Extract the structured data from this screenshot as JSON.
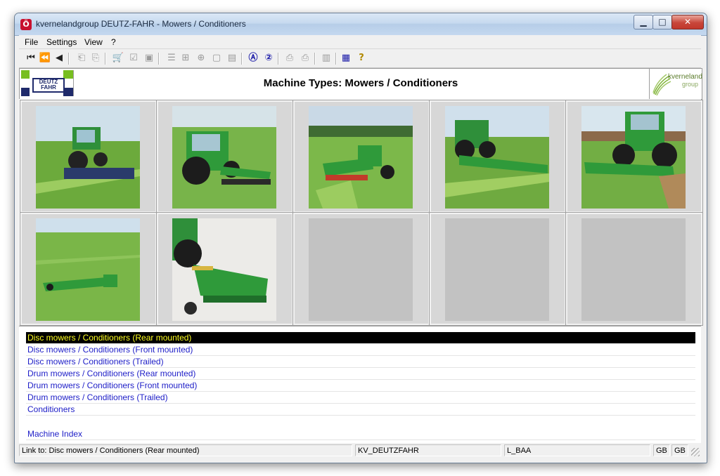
{
  "window": {
    "title": "kvernelandgroup DEUTZ-FAHR - Mowers / Conditioners",
    "app_icon": "Ö",
    "controls": {
      "minimize": "▁",
      "maximize": "□",
      "close": "✕"
    }
  },
  "menu": {
    "items": [
      {
        "label": "File"
      },
      {
        "label": "Settings"
      },
      {
        "label": "View"
      },
      {
        "label": "?"
      }
    ]
  },
  "toolbar": {
    "buttons": [
      {
        "icon": "first-page-icon",
        "glyph": "⏮"
      },
      {
        "icon": "fast-back-icon",
        "glyph": "⏪"
      },
      {
        "icon": "back-icon",
        "glyph": "◀"
      },
      {
        "icon": "doc-prev-icon",
        "glyph": "⎗"
      },
      {
        "icon": "doc-next-icon",
        "glyph": "⎘"
      },
      {
        "icon": "cart-icon",
        "glyph": "🛒"
      },
      {
        "icon": "checklist-icon",
        "glyph": "☑"
      },
      {
        "icon": "stamp-icon",
        "glyph": "▣"
      },
      {
        "icon": "text-doc-icon",
        "glyph": "☰"
      },
      {
        "icon": "tree-icon",
        "glyph": "⊞"
      },
      {
        "icon": "zoom-icon",
        "glyph": "⊕"
      },
      {
        "icon": "page-icon",
        "glyph": "▢"
      },
      {
        "icon": "pages-icon",
        "glyph": "▤"
      },
      {
        "icon": "search-a-icon",
        "glyph": "Ⓐ"
      },
      {
        "icon": "search-2-icon",
        "glyph": "②"
      },
      {
        "icon": "print-icon",
        "glyph": "⎙"
      },
      {
        "icon": "print-preview-icon",
        "glyph": "⎙"
      },
      {
        "icon": "book-icon",
        "glyph": "▥"
      },
      {
        "icon": "grid-icon",
        "glyph": "▦"
      },
      {
        "icon": "help-icon",
        "glyph": "?"
      }
    ]
  },
  "header": {
    "title": "Machine Types: Mowers / Conditioners",
    "left_logo": "DEUTZ FAHR",
    "right_logo_line1": "kverneland",
    "right_logo_line2": "group"
  },
  "grid": {
    "tiles": [
      {
        "id": 1,
        "kind": "rear-mower"
      },
      {
        "id": 2,
        "kind": "front-mower"
      },
      {
        "id": 3,
        "kind": "trailed-field"
      },
      {
        "id": 4,
        "kind": "wide-rear"
      },
      {
        "id": 5,
        "kind": "front-wide"
      },
      {
        "id": 6,
        "kind": "trailed-distant"
      },
      {
        "id": 7,
        "kind": "studio-conditioner"
      },
      {
        "id": 8,
        "kind": "empty"
      },
      {
        "id": 9,
        "kind": "empty"
      },
      {
        "id": 10,
        "kind": "empty"
      }
    ]
  },
  "links": {
    "items": [
      {
        "label": "Disc mowers / Conditioners (Rear mounted)",
        "selected": true
      },
      {
        "label": "Disc mowers / Conditioners (Front mounted)"
      },
      {
        "label": "Disc mowers / Conditioners (Trailed)"
      },
      {
        "label": "Drum mowers / Conditioners (Rear mounted)"
      },
      {
        "label": "Drum mowers / Conditioners (Front mounted)"
      },
      {
        "label": "Drum mowers / Conditioners (Trailed)"
      },
      {
        "label": "Conditioners"
      }
    ],
    "machine_index": "Machine Index"
  },
  "status": {
    "link_text": "Link to: Disc mowers / Conditioners (Rear mounted)",
    "database": "KV_DEUTZFAHR",
    "code": "L_BAA",
    "lang1": "GB",
    "lang2": "GB"
  },
  "colors": {
    "link": "#2020c8",
    "selected_bg": "#000000",
    "selected_fg": "#ffff20",
    "tractor_green": "#2f9a3a",
    "grass": "#6cae3e"
  }
}
